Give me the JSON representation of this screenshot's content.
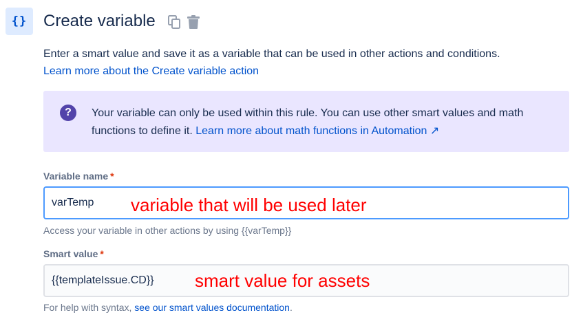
{
  "header": {
    "icon_glyph": "{}",
    "title": "Create variable",
    "copy_icon": "copy-icon",
    "delete_icon": "trash-icon"
  },
  "description": {
    "text": "Enter a smart value and save it as a variable that can be used in other actions and conditions.",
    "link": "Learn more about the Create variable action"
  },
  "info": {
    "icon": "question-icon",
    "text": "Your variable can only be used within this rule. You can use other smart values and math functions to define it. ",
    "link": "Learn more about math functions in Automation ↗"
  },
  "variable_name": {
    "label": "Variable name",
    "required_marker": "*",
    "value": "varTemp",
    "help": "Access your variable in other actions by using {{varTemp}}"
  },
  "smart_value": {
    "label": "Smart value",
    "required_marker": "*",
    "value": "{{templateIssue.CD}}",
    "help_prefix": "For help with syntax, ",
    "help_link": "see our smart values documentation",
    "help_suffix": "."
  },
  "annotations": {
    "variable": "variable that will be used later",
    "smart": "smart value for assets"
  },
  "colors": {
    "annotation": "#ff0000",
    "link": "#0052cc",
    "info_bg": "#eae6ff",
    "focus_border": "#4c9aff",
    "required": "#de350b"
  }
}
